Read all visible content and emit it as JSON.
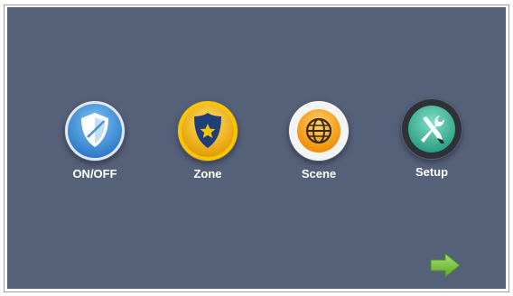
{
  "menu": {
    "items": [
      {
        "id": "onoff",
        "label": "ON/OFF",
        "icon": "shield-icon",
        "color": "#3f8fd6"
      },
      {
        "id": "zone",
        "label": "Zone",
        "icon": "police-badge-icon",
        "color": "#f2b705"
      },
      {
        "id": "scene",
        "label": "Scene",
        "icon": "globe-icon",
        "color": "#f5a623"
      },
      {
        "id": "setup",
        "label": "Setup",
        "icon": "tools-icon",
        "color": "#3fb89a"
      }
    ]
  },
  "navigation": {
    "next_icon": "right-arrow-icon",
    "next_color": "#7bc142"
  },
  "theme": {
    "background": "#556079",
    "label_color": "#ffffff"
  }
}
